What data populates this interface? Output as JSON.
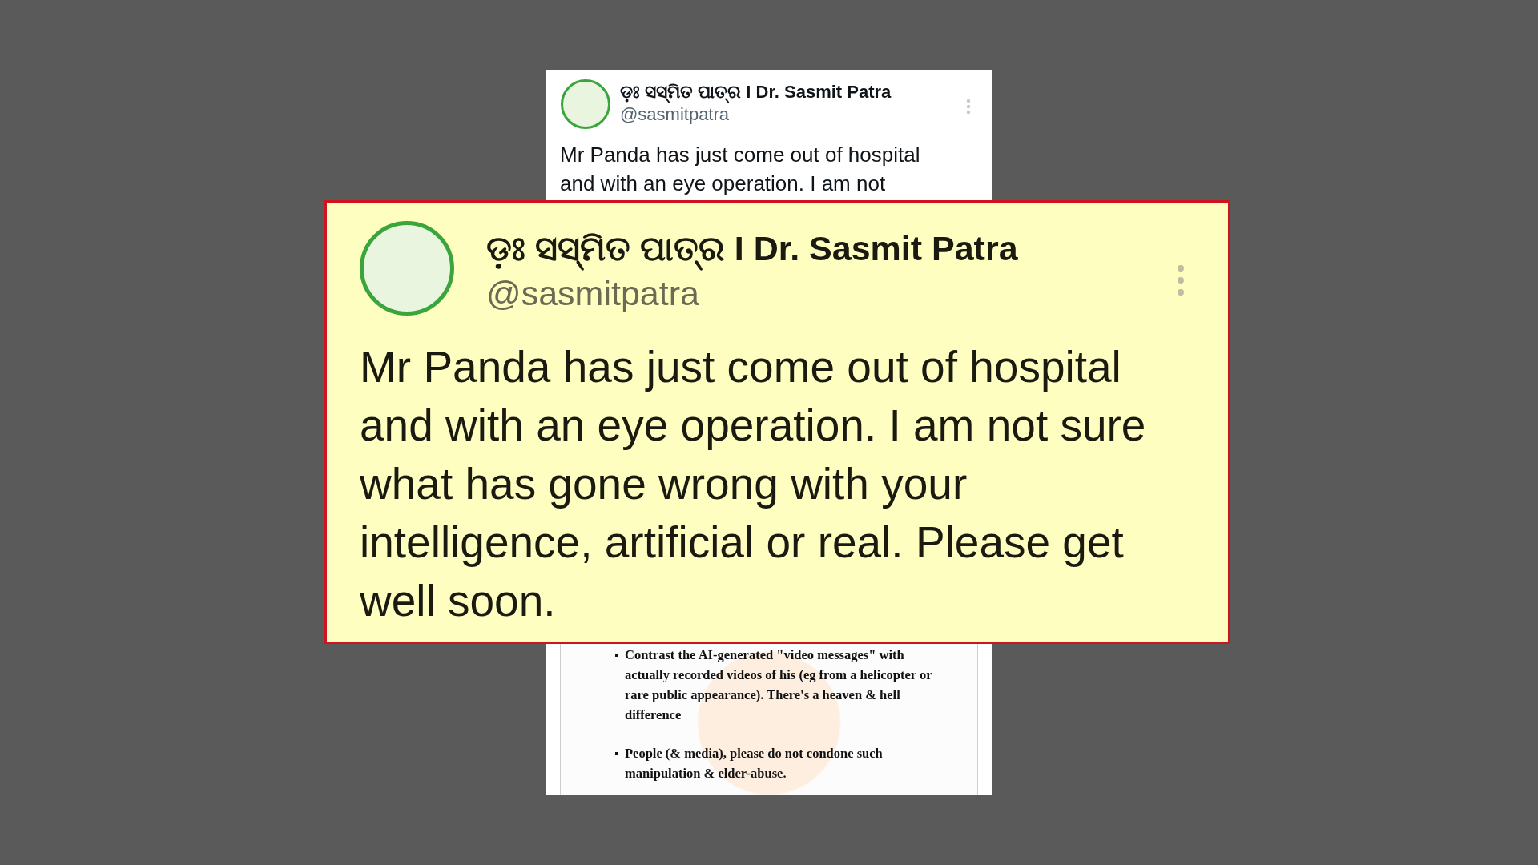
{
  "tweet": {
    "display_name": "ଡ଼ଃ ସସ୍ମିତ ପାତ୍ର I Dr. Sasmit Patra",
    "handle": "@sasmitpatra",
    "text": "Mr Panda has just come out of hospital and with an eye operation. I am not",
    "attached_image": {
      "bullets": [
        "Contrast the AI-generated \"video messages\" with actually recorded videos of his (eg from a helicopter or rare public appearance). There's a heaven & hell difference",
        "People (& media), please do not condone such manipulation & elder-abuse."
      ]
    }
  },
  "highlight": {
    "display_name": "ଡ଼ଃ ସସ୍ମିତ ପାତ୍ର I Dr. Sasmit Patra",
    "handle": "@sasmitpatra",
    "text": "Mr Panda has just come out of hospital and with an eye operation. I am not sure what has gone wrong with your intelligence, artificial or real. Please get well soon."
  }
}
